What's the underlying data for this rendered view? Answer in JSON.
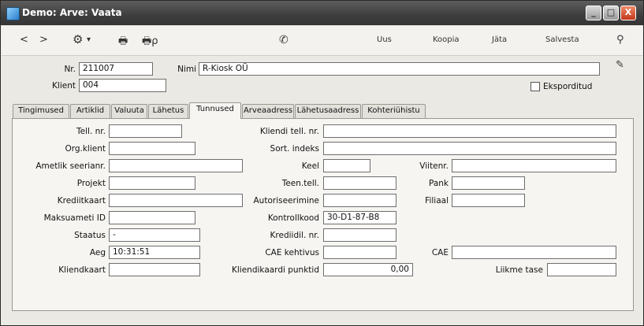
{
  "window": {
    "title": "Demo: Arve: Vaata",
    "min": "_",
    "max": "□",
    "close": "X"
  },
  "toolbar": {
    "back": "<",
    "forward": ">",
    "gear": "⚙",
    "gear_caret": "▾",
    "print": "🖶",
    "print_preview": "🖶ρ",
    "phone": "✆",
    "uus": "Uus",
    "koopia": "Koopia",
    "jata": "Jäta",
    "salvesta": "Salvesta",
    "pin": "⚲"
  },
  "header": {
    "nr_label": "Nr.",
    "nr_value": "211007",
    "nimi_label": "Nimi",
    "nimi_value": "R-Kiosk OÜ",
    "klient_label": "Klient",
    "klient_value": "004",
    "eksporditud_label": "Eksporditud",
    "eksporditud_checked": false
  },
  "tabs": [
    "Tingimused",
    "Artiklid",
    "Valuuta",
    "Lähetus",
    "Tunnused",
    "Arveaadress",
    "Lähetusaadress",
    "Kohteriühistu"
  ],
  "active_tab": "Tunnused",
  "fields": {
    "tell_nr": {
      "label": "Tell. nr.",
      "value": ""
    },
    "org_klient": {
      "label": "Org.klient",
      "value": ""
    },
    "ametlik_seerianr": {
      "label": "Ametlik seerianr.",
      "value": ""
    },
    "projekt": {
      "label": "Projekt",
      "value": ""
    },
    "krediitkaart": {
      "label": "Krediitkaart",
      "value": ""
    },
    "maksuameti_id": {
      "label": "Maksuameti ID",
      "value": ""
    },
    "staatus": {
      "label": "Staatus",
      "value": "-"
    },
    "aeg": {
      "label": "Aeg",
      "value": "10:31:51"
    },
    "kliendkaart": {
      "label": "Kliendkaart",
      "value": ""
    },
    "kliendi_tell_nr": {
      "label": "Kliendi tell. nr.",
      "value": ""
    },
    "sort_indeks": {
      "label": "Sort. indeks",
      "value": ""
    },
    "keel": {
      "label": "Keel",
      "value": ""
    },
    "viitenr": {
      "label": "Viitenr.",
      "value": ""
    },
    "teen_tell": {
      "label": "Teen.tell.",
      "value": ""
    },
    "pank": {
      "label": "Pank",
      "value": ""
    },
    "autoriseerimine": {
      "label": "Autoriseerimine",
      "value": ""
    },
    "filiaal": {
      "label": "Filiaal",
      "value": ""
    },
    "kontrollkood": {
      "label": "Kontrollkood",
      "value": "30-D1-87-B8"
    },
    "krediidil_nr": {
      "label": "Krediidil. nr.",
      "value": ""
    },
    "cae_kehtivus": {
      "label": "CAE kehtivus",
      "value": ""
    },
    "cae": {
      "label": "CAE",
      "value": ""
    },
    "kliendikaardi_punktid": {
      "label": "Kliendikaardi punktid",
      "value": "0,00"
    },
    "liikme_tase": {
      "label": "Liikme tase",
      "value": ""
    }
  }
}
